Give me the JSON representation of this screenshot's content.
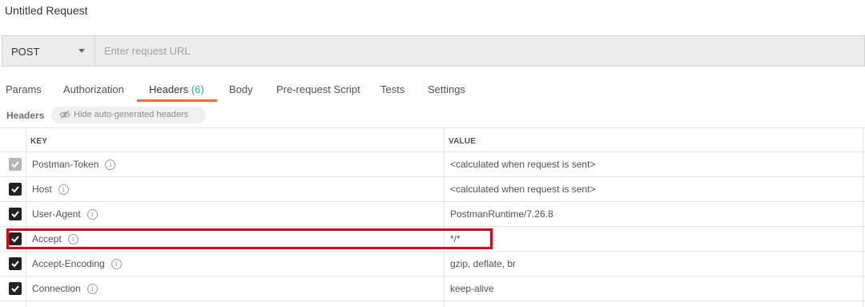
{
  "request": {
    "title": "Untitled Request",
    "method": "POST",
    "url_value": "",
    "url_placeholder": "Enter request URL"
  },
  "tabs": [
    {
      "label": "Params"
    },
    {
      "label": "Authorization"
    },
    {
      "label": "Headers",
      "count": "(6)",
      "active": true
    },
    {
      "label": "Body"
    },
    {
      "label": "Pre-request Script"
    },
    {
      "label": "Tests"
    },
    {
      "label": "Settings"
    }
  ],
  "headers_section": {
    "label": "Headers",
    "toggle_label": "Hide auto-generated headers"
  },
  "table": {
    "columns": [
      "KEY",
      "VALUE"
    ],
    "rows": [
      {
        "key": "Postman-Token",
        "value": "<calculated when request is sent>",
        "checked": true,
        "disabled": true
      },
      {
        "key": "Host",
        "value": "<calculated when request is sent>",
        "checked": true
      },
      {
        "key": "User-Agent",
        "value": "PostmanRuntime/7.26.8",
        "checked": true
      },
      {
        "key": "Accept",
        "value": "*/*",
        "checked": true,
        "highlighted": true
      },
      {
        "key": "Accept-Encoding",
        "value": "gzip, deflate, br",
        "checked": true
      },
      {
        "key": "Connection",
        "value": "keep-alive",
        "checked": true
      }
    ]
  },
  "colors": {
    "accent_underline": "#f26b3a",
    "count_green": "#26b47f",
    "highlight_red": "#e2001a"
  },
  "icons": {
    "method_dropdown": "chevron-down-icon",
    "hide_headers": "eye-slash-icon",
    "info": "info-icon",
    "checkbox": "checkmark-icon"
  }
}
